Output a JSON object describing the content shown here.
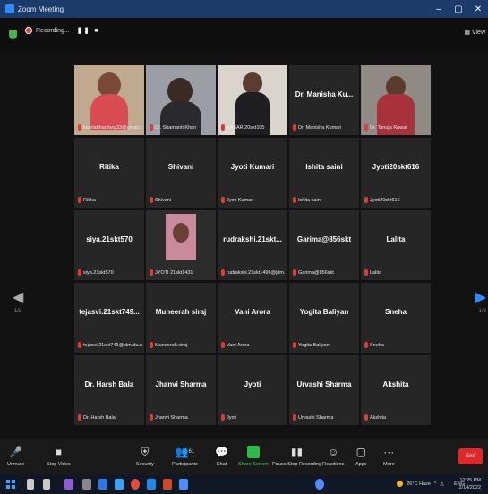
{
  "window": {
    "title": "Zoom Meeting",
    "controls": [
      "–",
      "▢",
      "✕"
    ]
  },
  "topbar": {
    "recording_label": "Recording...",
    "recording_controls": "❚❚ ■",
    "view_label": "▦ View"
  },
  "participants": [
    {
      "display": "",
      "label": "kamlabhardwaj33@gmail.c...",
      "video": "woman-red"
    },
    {
      "display": "",
      "label": "Dr. Shamanti Khan",
      "video": "woman-glasses"
    },
    {
      "display": "",
      "label": "ABSAR 20skt105",
      "video": "man-dark"
    },
    {
      "display": "Dr. Manisha Ku...",
      "label": "Dr. Manisha Kumari",
      "video": ""
    },
    {
      "display": "",
      "label": "Dr. Tanuja Rawal",
      "video": "woman-saree"
    },
    {
      "display": "Ritika",
      "label": "Ritika",
      "video": ""
    },
    {
      "display": "Shivani",
      "label": "Shivani",
      "video": ""
    },
    {
      "display": "Jyoti Kumari",
      "label": "Jyoti Kumari",
      "video": ""
    },
    {
      "display": "Ishita saini",
      "label": "Ishita saini",
      "video": ""
    },
    {
      "display": "Jyoti20skt616",
      "label": "Jyoti20skt616",
      "video": ""
    },
    {
      "display": "siya.21skt570",
      "label": "siya.21skt570",
      "video": ""
    },
    {
      "display": "",
      "label": "JYOTI 21skt1431",
      "video": "pink-room"
    },
    {
      "display": "rudrakshi.21skt...",
      "label": "rudrakshi.21skt1496@jdm...",
      "video": ""
    },
    {
      "display": "Garima@856skt",
      "label": "Garima@856skt",
      "video": ""
    },
    {
      "display": "Lalita",
      "label": "Lalita",
      "video": ""
    },
    {
      "display": "tejasvi.21skt749...",
      "label": "tejasvi.21skt749@jdm.du.ac...",
      "video": ""
    },
    {
      "display": "Muneerah siraj",
      "label": "Muneerah siraj",
      "video": ""
    },
    {
      "display": "Vani Arora",
      "label": "Vani Arora",
      "video": ""
    },
    {
      "display": "Yogita Baliyan",
      "label": "Yogita Baliyan",
      "video": ""
    },
    {
      "display": "Sneha",
      "label": "Sneha",
      "video": ""
    },
    {
      "display": "Dr. Harsh Bala",
      "label": "Dr. Harsh Bala",
      "video": ""
    },
    {
      "display": "Jhanvi Sharma",
      "label": "Jhanvi Sharma",
      "video": ""
    },
    {
      "display": "Jyoti",
      "label": "Jyoti",
      "video": ""
    },
    {
      "display": "Urvashi Sharma",
      "label": "Urvashi Sharma",
      "video": ""
    },
    {
      "display": "Akshita",
      "label": "Akshita",
      "video": ""
    }
  ],
  "pagination": {
    "left": "1/3",
    "right": "1/3"
  },
  "toolbar": {
    "unmute": "Unmute",
    "stop_video": "Stop Video",
    "security": "Security",
    "participants": "Participants",
    "participants_count": "61",
    "chat": "Chat",
    "share_screen": "Share Screen",
    "recording": "Pause/Stop Recording",
    "reactions": "Reactions",
    "apps": "Apps",
    "more": "More",
    "end": "End"
  },
  "taskbar": {
    "weather": "26°C Haze",
    "lang": "ENG",
    "time": "12:25 PM",
    "date": "2/14/2022"
  },
  "colors": {
    "active_speaker": "#d6e03a",
    "share_green": "#2db84a",
    "end_red": "#e02828",
    "mute_red": "#e53935"
  }
}
